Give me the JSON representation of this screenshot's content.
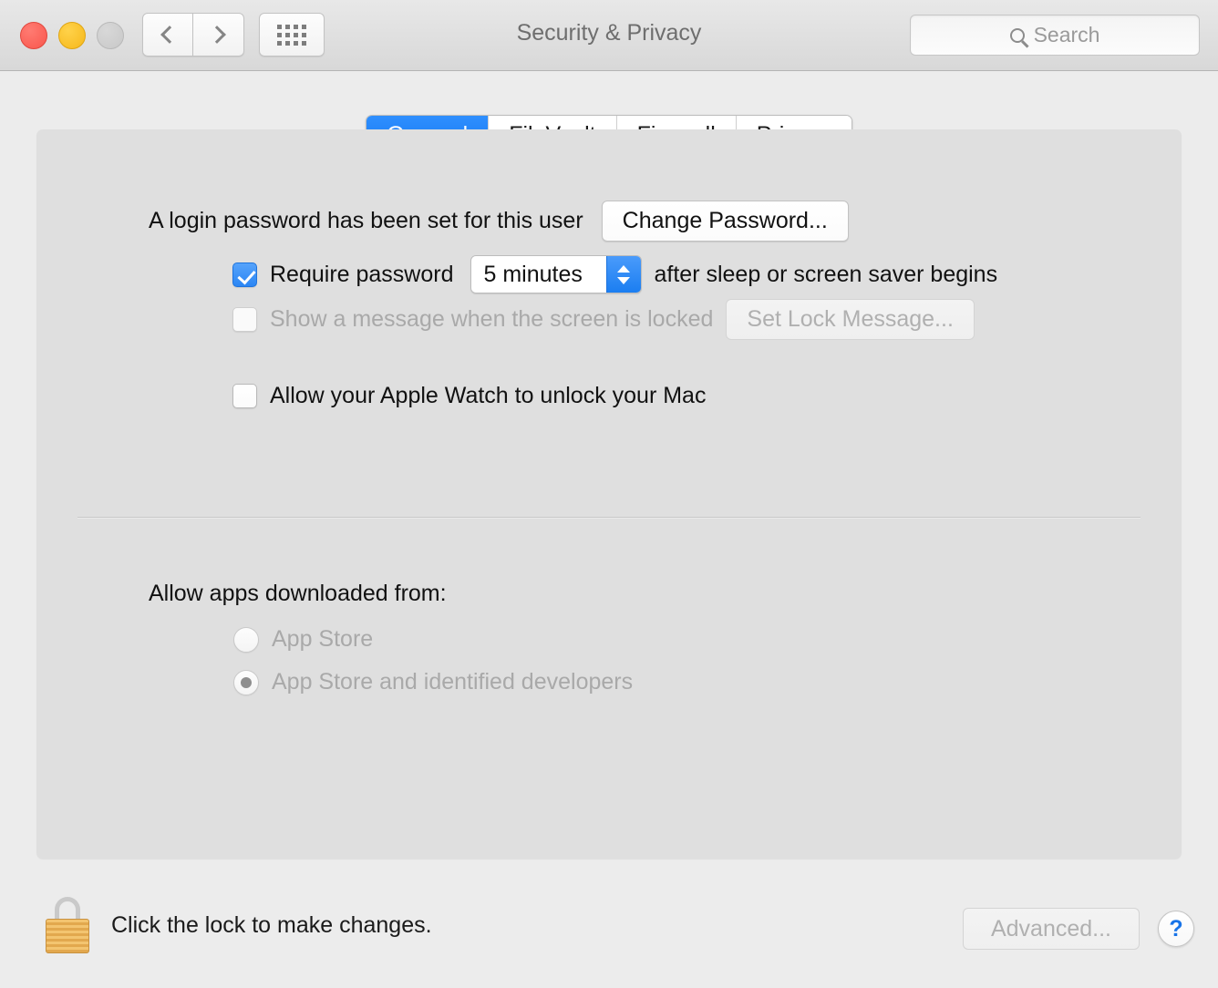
{
  "window": {
    "title": "Security & Privacy",
    "traffic_lights": [
      "close",
      "minimize",
      "zoom"
    ]
  },
  "toolbar": {
    "back_icon": "chevron-left-icon",
    "forward_icon": "chevron-right-icon",
    "show_all_icon": "grid-icon",
    "search": {
      "icon": "search-icon",
      "placeholder": "Search",
      "value": ""
    }
  },
  "tabs": [
    {
      "label": "General",
      "active": true
    },
    {
      "label": "FileVault",
      "active": false
    },
    {
      "label": "Firewall",
      "active": false
    },
    {
      "label": "Privacy",
      "active": false
    }
  ],
  "general": {
    "login_password_text": "A login password has been set for this user",
    "change_password_label": "Change Password...",
    "require_password": {
      "checked": true,
      "label": "Require password",
      "delay_value": "5 minutes",
      "suffix": "after sleep or screen saver begins"
    },
    "lock_message": {
      "checked": false,
      "enabled": false,
      "label": "Show a message when the screen is locked",
      "button_label": "Set Lock Message..."
    },
    "apple_watch": {
      "checked": false,
      "label": "Allow your Apple Watch to unlock your Mac"
    },
    "allow_apps": {
      "heading": "Allow apps downloaded from:",
      "enabled": false,
      "options": [
        {
          "label": "App Store",
          "selected": false
        },
        {
          "label": "App Store and identified developers",
          "selected": true
        }
      ]
    }
  },
  "footer": {
    "lock_icon": "padlock-closed-icon",
    "lock_text": "Click the lock to make changes.",
    "advanced_label": "Advanced...",
    "advanced_enabled": false,
    "help_label": "?"
  },
  "colors": {
    "accent_blue": "#1b7ef1",
    "window_bg": "#ececec",
    "panel_bg": "#dfdfdf",
    "title_text": "#6e6e6e",
    "disabled_text": "#a9a9a9",
    "lock_gold": "#e2a84e",
    "help_blue": "#1874e8"
  }
}
